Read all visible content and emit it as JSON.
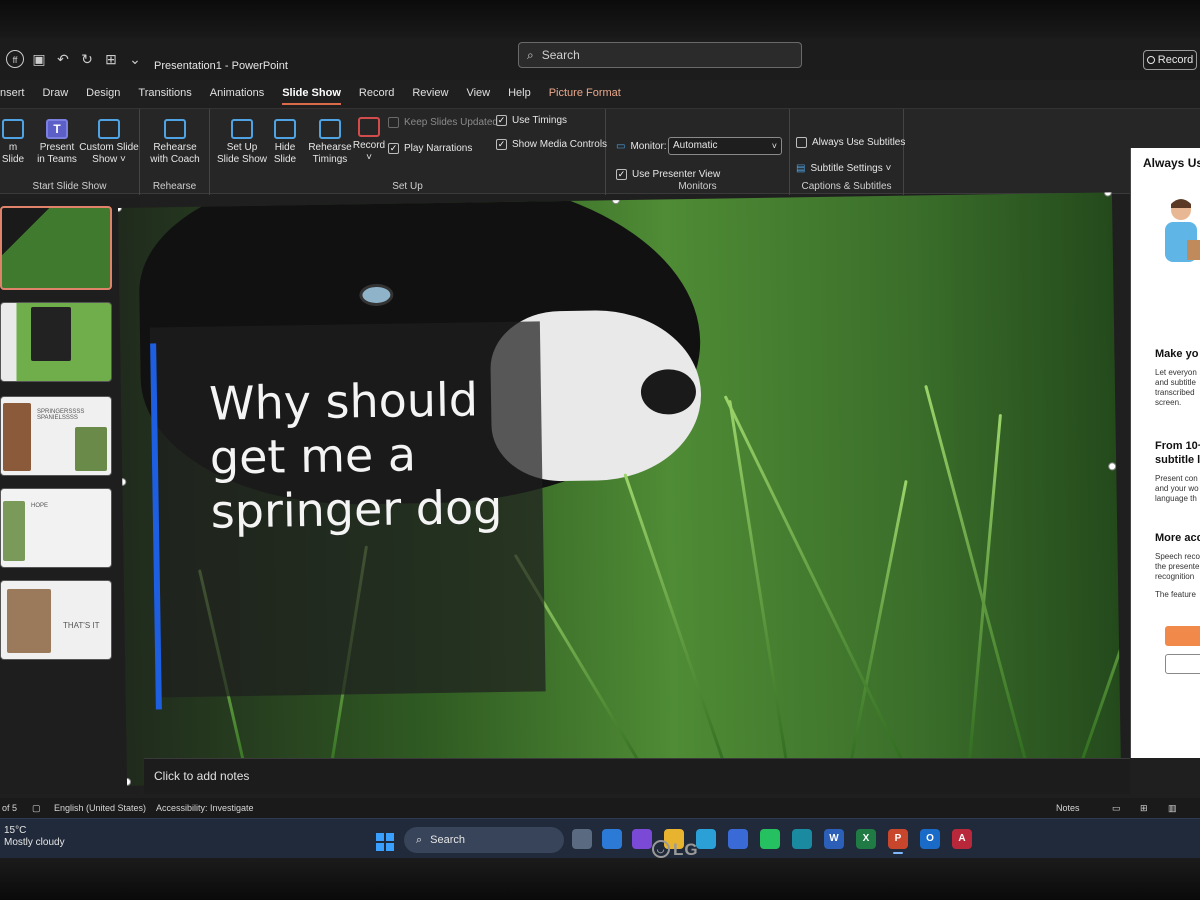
{
  "window": {
    "title": "Presentation1  -  PowerPoint",
    "search_placeholder": "Search",
    "record_button": "Record",
    "account_initials": "ff"
  },
  "ribbon_tabs": [
    "nsert",
    "Draw",
    "Design",
    "Transitions",
    "Animations",
    "Slide Show",
    "Record",
    "Review",
    "View",
    "Help",
    "Picture Format"
  ],
  "active_tab": "Slide Show",
  "ribbon": {
    "start_group": {
      "from_slide": "m\nSlide",
      "present_in_teams": "Present\nin Teams",
      "custom_slide_show": "Custom Slide\nShow ˅",
      "label": "Start Slide Show"
    },
    "rehearse_group": {
      "rehearse_with_coach": "Rehearse\nwith Coach",
      "label": "Rehearse"
    },
    "setup_group": {
      "set_up_slide_show": "Set Up\nSlide Show",
      "hide_slide": "Hide\nSlide",
      "rehearse_timings": "Rehearse\nTimings",
      "record": "Record\n˅",
      "keep_slides_updated": "Keep Slides Updated",
      "use_timings": "Use Timings",
      "play_narrations": "Play Narrations",
      "show_media_controls": "Show Media Controls",
      "label": "Set Up"
    },
    "monitors_group": {
      "monitor_label": "Monitor:",
      "monitor_value": "Automatic",
      "use_presenter_view": "Use Presenter View",
      "label": "Monitors"
    },
    "captions_group": {
      "always_use_subtitles": "Always Use Subtitles",
      "subtitle_settings": "Subtitle Settings ˅",
      "label": "Captions & Subtitles"
    }
  },
  "thumbnails": {
    "slide3_text": "SPRINGERSSSS\nSPANIELSSSS",
    "slide4_text": "HOPE",
    "slide5_text": "THAT'S IT"
  },
  "slide": {
    "title": "Why should get me a springer dog",
    "accent_color": "#1d5fe0"
  },
  "notes_placeholder": "Click to add notes",
  "right_pane": {
    "header": "Always Us",
    "heading1": "Make yo",
    "text1": [
      "Let everyon",
      "and subtitle",
      "transcribed",
      "screen."
    ],
    "heading2": "From 10+",
    "heading2b": "subtitle la",
    "text2": [
      "Present con",
      "and your wo",
      "language th"
    ],
    "heading3": "More acc",
    "text3": [
      "Speech reco",
      "the presente",
      "recognition"
    ],
    "text4": "The feature"
  },
  "status": {
    "slide_count": "of 5",
    "language": "English (United States)",
    "accessibility": "Accessibility: Investigate",
    "notes": "Notes"
  },
  "taskbar": {
    "temperature": "15°C",
    "weather": "Mostly cloudy",
    "search": "Search"
  },
  "monitor_brand": "LG"
}
